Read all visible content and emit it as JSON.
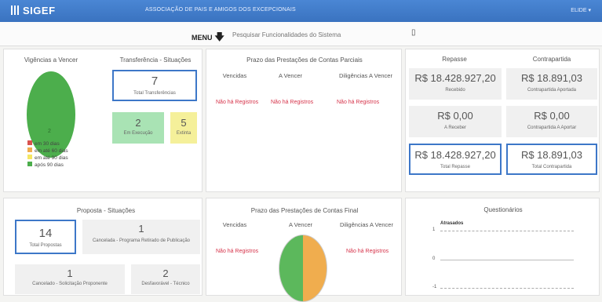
{
  "header": {
    "logo": "SIGEF",
    "org": "ASSOCIAÇÃO DE PAIS E AMIGOS DOS EXCEPCIONAIS",
    "user": "ELIDE"
  },
  "menubar": {
    "menu_label": "MENU",
    "search_placeholder": "Pesquisar Funcionalidades do Sistema"
  },
  "vigencias": {
    "title": "Vigências a Vencer",
    "pie_value": "2",
    "legend": [
      {
        "label": "em 30 dias",
        "color": "#d9534f"
      },
      {
        "label": "em até 60 dias",
        "color": "#f0ad4e"
      },
      {
        "label": "em até 90 dias",
        "color": "#f5e663"
      },
      {
        "label": "após 90 dias",
        "color": "#4cae4c"
      }
    ]
  },
  "transferencia": {
    "title": "Transferência - Situações",
    "total": {
      "value": "7",
      "label": "Total Transferências"
    },
    "execucao": {
      "value": "2",
      "label": "Em Execução"
    },
    "extinta": {
      "value": "5",
      "label": "Extinta"
    }
  },
  "prazo_parciais": {
    "title": "Prazo das Prestações de Contas Parciais",
    "columns": [
      "Vencidas",
      "A Vencer",
      "Diligências A Vencer"
    ],
    "values": [
      "Não há Registros",
      "Não há Registros",
      "Não há Registros"
    ]
  },
  "repasse": {
    "headers": [
      "Repasse",
      "Contrapartida"
    ],
    "recebido": {
      "value": "R$ 18.428.927,20",
      "label": "Recebido"
    },
    "contrapartida_aportada": {
      "value": "R$ 18.891,03",
      "label": "Contrapartida Aportada"
    },
    "a_receber": {
      "value": "R$ 0,00",
      "label": "A Receber"
    },
    "contrapartida_a_aportar": {
      "value": "R$ 0,00",
      "label": "Contrapartida A Aportar"
    },
    "total_repasse": {
      "value": "R$ 18.428.927,20",
      "label": "Total Repasse"
    },
    "total_contrapartida": {
      "value": "R$ 18.891,03",
      "label": "Total Contrapartida"
    }
  },
  "proposta": {
    "title": "Proposta - Situações",
    "total": {
      "value": "14",
      "label": "Total Propostas"
    },
    "cancelada": {
      "value": "1",
      "label": "Cancelada - Programa Retirado de Publicação"
    },
    "cancelado_sol": {
      "value": "1",
      "label": "Cancelado - Solicitação Proponente"
    },
    "desfavoravel": {
      "value": "2",
      "label": "Desfavorável - Técnico"
    }
  },
  "prazo_final": {
    "title": "Prazo das Prestações de Contas Final",
    "columns": [
      "Vencidas",
      "A Vencer",
      "Diligências A Vencer"
    ],
    "vencidas": "Não há Registros",
    "diligencias": "Não há Registros",
    "pie_colors": {
      "green": "#5cb85c",
      "orange": "#f0ad4e"
    }
  },
  "questionarios": {
    "title": "Questionários",
    "series_label": "Atrasados",
    "ticks": [
      "1",
      "0",
      "-1"
    ]
  }
}
